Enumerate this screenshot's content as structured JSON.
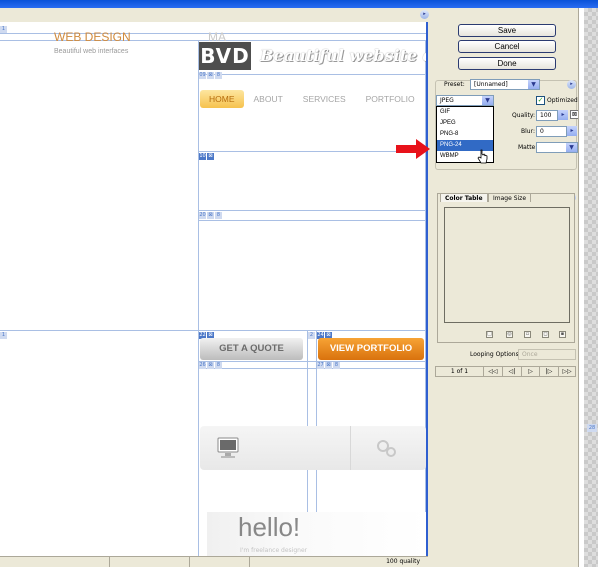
{
  "buttons": {
    "save": "Save",
    "cancel": "Cancel",
    "done": "Done"
  },
  "settings": {
    "preset_label": "Preset:",
    "preset_value": "[Unnamed]",
    "format_value": "JPEG",
    "format_options": [
      "GIF",
      "JPEG",
      "PNG-8",
      "PNG-24",
      "WBMP"
    ],
    "highlighted_option": "PNG-24",
    "optimized_label": "Optimized",
    "optimized_checked": true,
    "quality_label": "Quality:",
    "quality_value": "100",
    "blur_label": "Blur:",
    "blur_value": "0",
    "matte_label": "Matte:"
  },
  "tabs": {
    "color_table": "Color Table",
    "image_size": "Image Size"
  },
  "animation": {
    "looping_label": "Looping Options:",
    "looping_value": "Once",
    "frame_counter": "1 of 1",
    "controls": [
      "◁◁",
      "◁|",
      "▷",
      "|▷",
      "▷▷"
    ]
  },
  "status": {
    "quality_text": "100 quality"
  },
  "preview": {
    "logo_text": "BVD",
    "tagline": "Beautiful website desig",
    "nav": [
      "HOME",
      "ABOUT",
      "SERVICES",
      "PORTFOLIO"
    ],
    "get_quote": "GET A QUOTE",
    "view_portfolio": "VIEW PORTFOLIO",
    "service_title": "WEB DESIGN",
    "service_sub": "Beautiful web interfaces",
    "service2_title": "MA",
    "hello": "hello!",
    "hello_sub": "I'm freelance designer",
    "slices": [
      {
        "id": "03",
        "n": "01"
      },
      {
        "id": "10",
        "n": ""
      },
      {
        "id": "20",
        "n": ""
      },
      {
        "id": "22",
        "n": ""
      },
      {
        "id": "24",
        "n": ""
      }
    ]
  },
  "colors": {
    "accent_blue": "#316ac5",
    "arrow_red": "#e8121a",
    "orange": "#e58615"
  }
}
